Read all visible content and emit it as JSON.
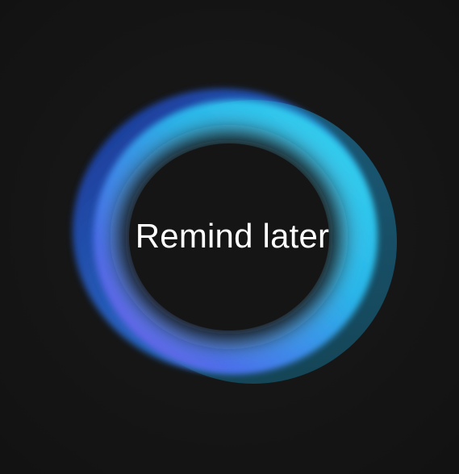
{
  "button": {
    "label": "Remind later"
  },
  "icons": {
    "ring": "glowing-ring-icon"
  },
  "colors": {
    "background": "#161616",
    "ring_cyan": "#2fd0ef",
    "ring_blue": "#2b6fe0",
    "ring_violet": "#6a3ce6",
    "ring_navy": "#1f3fb3",
    "label": "#ffffff"
  }
}
